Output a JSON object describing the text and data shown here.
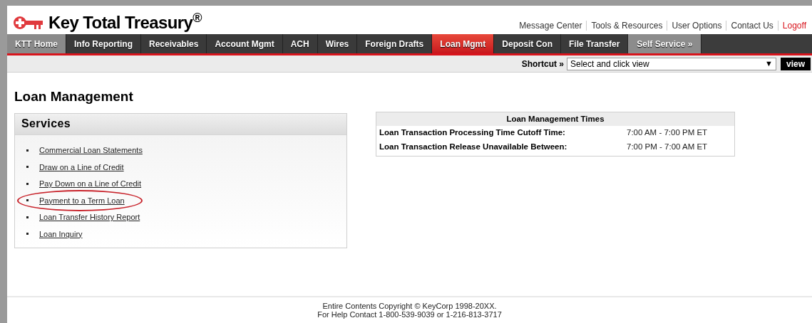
{
  "brand": {
    "title": "Key Total Treasury$^{®}$"
  },
  "top_links": [
    {
      "label": "Message Center",
      "kind": "plain"
    },
    {
      "label": "Tools & Resources",
      "kind": "plain"
    },
    {
      "label": "User Options",
      "kind": "plain"
    },
    {
      "label": "Contact Us",
      "kind": "plain"
    },
    {
      "label": "Logoff",
      "kind": "logoff"
    }
  ],
  "nav_tabs": [
    {
      "label": "KTT Home",
      "kind": "home",
      "selected": false
    },
    {
      "label": "Info Reporting",
      "kind": "menu",
      "selected": false
    },
    {
      "label": "Receivables",
      "kind": "menu",
      "selected": false
    },
    {
      "label": "Account Mgmt",
      "kind": "menu",
      "selected": false
    },
    {
      "label": "ACH",
      "kind": "menu",
      "selected": false
    },
    {
      "label": "Wires",
      "kind": "menu",
      "selected": false
    },
    {
      "label": "Foreign Drafts",
      "kind": "menu",
      "selected": false
    },
    {
      "label": "Loan Mgmt",
      "kind": "menu",
      "selected": true
    },
    {
      "label": "Deposit Con",
      "kind": "menu",
      "selected": false
    },
    {
      "label": "File Transfer",
      "kind": "menu",
      "selected": false
    },
    {
      "label": "Self Service »",
      "kind": "more",
      "selected": false
    }
  ],
  "shortcut": {
    "label": "Shortcut »",
    "select_value": "Select and click view",
    "arrow": "▼",
    "button": "view"
  },
  "page_title": "Loan Management",
  "services": {
    "title": "Services",
    "items": [
      {
        "label": "Commercial Loan Statements",
        "circled": false
      },
      {
        "label": "Draw on a Line of Credit",
        "circled": false
      },
      {
        "label": "Pay Down on a Line of Credit",
        "circled": false
      },
      {
        "label": "Payment to a Term Loan",
        "circled": true
      },
      {
        "label": "Loan Transfer History Report",
        "circled": false
      },
      {
        "label": "Loan Inquiry",
        "circled": false
      }
    ]
  },
  "times_table": {
    "title": "Loan Management Times",
    "rows": [
      {
        "label": "Loan Transaction Processing Time Cutoff Time:",
        "value": "7:00 AM - 7:00 PM ET"
      },
      {
        "label": "Loan Transaction Release Unavailable Between:",
        "value": "7:00 PM - 7:00 AM ET"
      }
    ]
  },
  "footer": [
    "Entire Contents Copyright © KeyCorp 1998-20XX.",
    "For Help Contact 1-800-539-9039 or 1-216-813-3717"
  ]
}
